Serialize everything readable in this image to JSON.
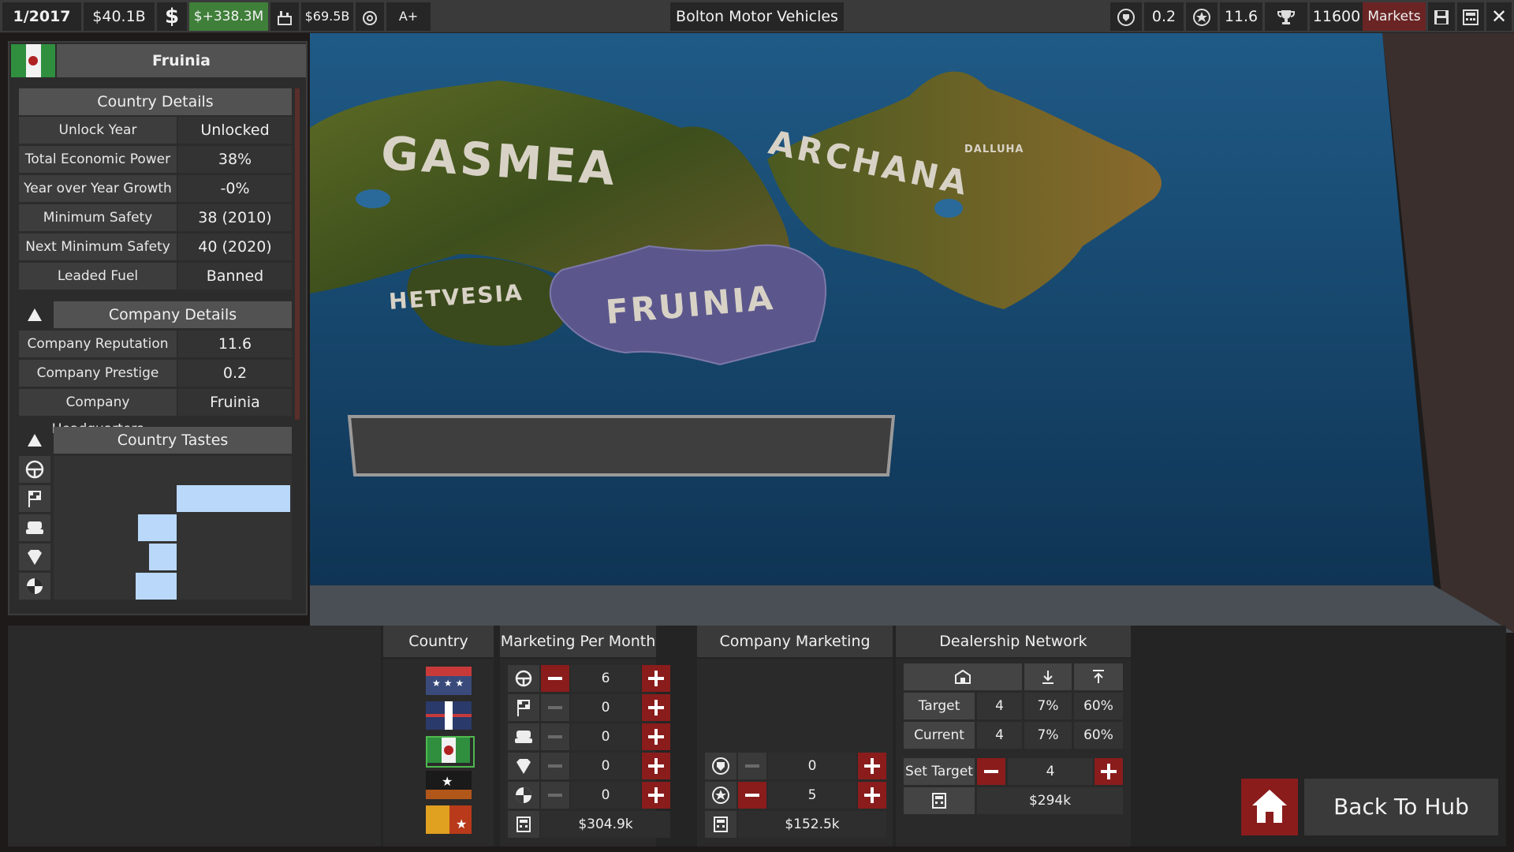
{
  "topbar": {
    "date": "1/2017",
    "cash": "$40.1B",
    "profit": "$+338.3M",
    "factory_value": "$69.5B",
    "credit_rating": "A+",
    "company_name": "Bolton Motor Vehicles",
    "prestige": "0.2",
    "reputation": "11.6",
    "score": "11600",
    "markets_label": "Markets"
  },
  "map": {
    "regions": [
      "GASMEA",
      "ARCHANA",
      "DALLUHA",
      "HETVESIA",
      "FRUINIA"
    ],
    "selected_color": "#5b578c"
  },
  "country_panel": {
    "name": "Fruinia",
    "details_title": "Country Details",
    "details": [
      {
        "label": "Unlock Year",
        "value": "Unlocked"
      },
      {
        "label": "Total Economic Power",
        "value": "38%"
      },
      {
        "label": "Year over Year Growth",
        "value": "-0%"
      },
      {
        "label": "Minimum Safety",
        "value": "38 (2010)"
      },
      {
        "label": "Next Minimum Safety",
        "value": "40 (2020)"
      },
      {
        "label": "Leaded Fuel",
        "value": "Banned"
      }
    ],
    "company_title": "Company Details",
    "company": [
      {
        "label": "Company Reputation",
        "value": "11.6"
      },
      {
        "label": "Company Prestige",
        "value": "0.2"
      },
      {
        "label": "Company Headquarters",
        "value": "Fruinia"
      }
    ],
    "tastes_title": "Country Tastes",
    "tastes": [
      {
        "icon": "steering-wheel-icon",
        "value": 0.0
      },
      {
        "icon": "checkered-flag-icon",
        "value": 0.5
      },
      {
        "icon": "car-seat-icon",
        "value": -0.17
      },
      {
        "icon": "gem-icon",
        "value": -0.12
      },
      {
        "icon": "crash-test-icon",
        "value": -0.18
      }
    ]
  },
  "bottom": {
    "headers": {
      "country": "Country",
      "marketing": "Marketing Per Month",
      "company_marketing": "Company Marketing",
      "dealership": "Dealership Network"
    },
    "marketing_rows": [
      {
        "icon": "steering-wheel-icon",
        "value": "6"
      },
      {
        "icon": "checkered-flag-icon",
        "value": "0"
      },
      {
        "icon": "car-seat-icon",
        "value": "0"
      },
      {
        "icon": "gem-icon",
        "value": "0"
      },
      {
        "icon": "crash-test-icon",
        "value": "0"
      }
    ],
    "marketing_total": "$304.9k",
    "company_marketing_rows": [
      {
        "icon": "prestige-shield-icon",
        "value": "0"
      },
      {
        "icon": "reputation-star-icon",
        "value": "5"
      }
    ],
    "company_marketing_total": "$152.5k",
    "dealership": {
      "target_label": "Target",
      "current_label": "Current",
      "target": [
        "4",
        "7%",
        "60%"
      ],
      "current": [
        "4",
        "7%",
        "60%"
      ],
      "set_target_label": "Set Target",
      "set_target_value": "4",
      "cost": "$294k"
    },
    "back_label": "Back To Hub"
  }
}
